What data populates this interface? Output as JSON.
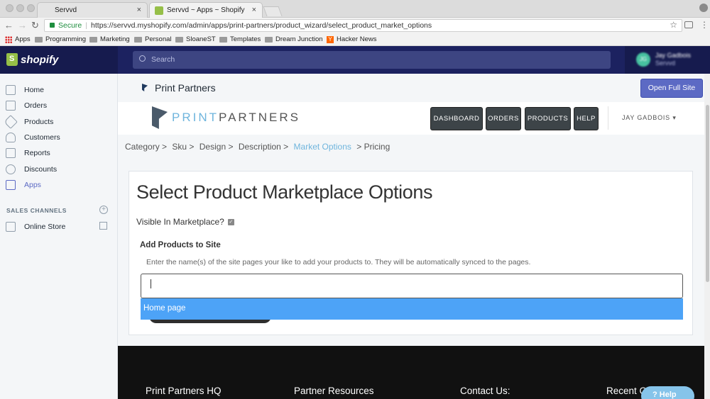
{
  "browser": {
    "tabs": [
      {
        "title": "Servvd",
        "close": ""
      },
      {
        "title": "Servvd ~ Apps ~ Shopify",
        "close": "×"
      }
    ],
    "secure_label": "Secure",
    "url": "https://servvd.myshopify.com/admin/apps/print-partners/product_wizard/select_product_market_options",
    "bookmarks": [
      "Apps",
      "Programming",
      "Marketing",
      "Personal",
      "SloaneST",
      "Templates",
      "Dream Junction",
      "Hacker News"
    ]
  },
  "shopify": {
    "logo_text": "shopify",
    "search_placeholder": "Search",
    "user": {
      "name": "Jay Gadbois",
      "store": "Servvd",
      "initials": "JG"
    },
    "nav": [
      {
        "label": "Home",
        "icon": "home-icon"
      },
      {
        "label": "Orders",
        "icon": "orders-icon"
      },
      {
        "label": "Products",
        "icon": "tag-icon"
      },
      {
        "label": "Customers",
        "icon": "person-icon"
      },
      {
        "label": "Reports",
        "icon": "bar-chart-icon"
      },
      {
        "label": "Discounts",
        "icon": "discount-icon"
      },
      {
        "label": "Apps",
        "icon": "apps-icon"
      }
    ],
    "sales_channels_label": "SALES CHANNELS",
    "online_store_label": "Online Store",
    "accent": "#5c6ac4"
  },
  "app": {
    "title": "Print Partners",
    "open_full_site": "Open Full Site",
    "logo_print": "PRINT",
    "logo_partners": "PARTNERS",
    "nav_buttons": [
      "DASHBOARD",
      "ORDERS",
      "PRODUCTS",
      "HELP"
    ],
    "account_label": "JAY GADBOIS",
    "breadcrumbs": [
      "Category >",
      "Sku >",
      "Design >",
      "Description >",
      "Market Options",
      "> Pricing"
    ],
    "heading": "Select Product Marketplace Options",
    "visible_label": "Visible In Marketplace?",
    "add_products_heading": "Add Products to Site",
    "help_text": "Enter the name(s) of the site pages your like to add your products to. They will be automatically synced to the pages.",
    "input_value": "",
    "dropdown_option": "Home page"
  },
  "footer": {
    "columns": [
      "Print Partners HQ",
      "Partner Resources",
      "Contact Us:",
      "Recent C"
    ],
    "help_button": "Help"
  }
}
